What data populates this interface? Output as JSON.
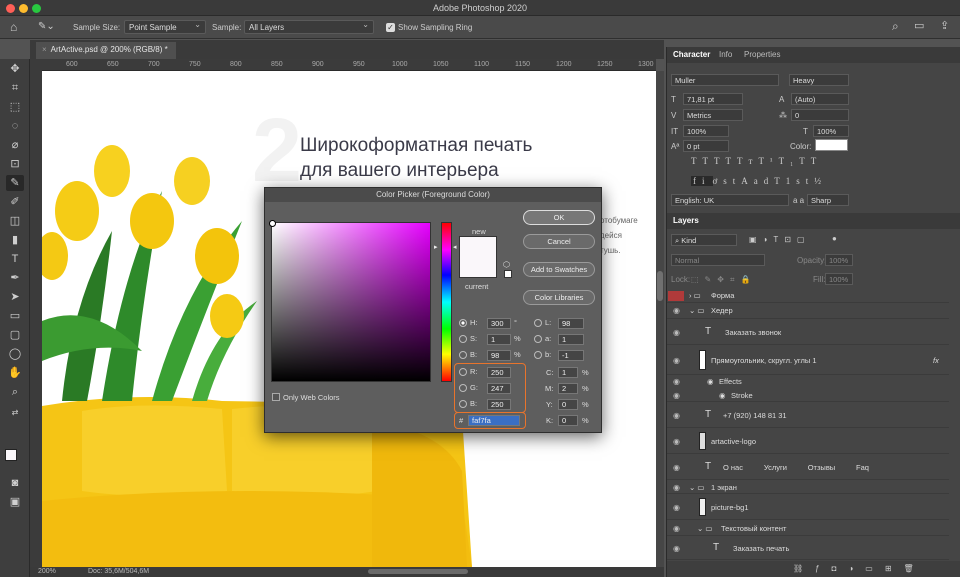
{
  "app": {
    "title": "Adobe Photoshop 2020"
  },
  "options_bar": {
    "sample_size_label": "Sample Size:",
    "sample_size_value": "Point Sample",
    "sample_label": "Sample:",
    "sample_value": "All Layers",
    "sampling_ring_label": "Show Sampling Ring"
  },
  "document": {
    "tab_label": "ArtActive.psd @ 200% (RGB/8) *",
    "zoom": "200%",
    "doc_info": "Doc: 35,6M/504,6M"
  },
  "ruler": {
    "ticks": [
      "600",
      "650",
      "700",
      "750",
      "800",
      "850",
      "900",
      "950",
      "1000",
      "1050",
      "1100",
      "1150",
      "1200",
      "1250",
      "1300"
    ]
  },
  "canvas": {
    "heading_line1": "Широкоформатная печать",
    "heading_line2": "для вашего интерьера",
    "side_text": [
      "отобумаге",
      "дейся",
      "тушь."
    ]
  },
  "character_panel": {
    "tabs": [
      "Character",
      "Info",
      "Properties"
    ],
    "font_family": "Muller",
    "font_style": "Heavy",
    "font_size": "71,81 pt",
    "leading": "(Auto)",
    "kerning": "Metrics",
    "tracking": "0",
    "vertical_scale": "100%",
    "horizontal_scale": "100%",
    "baseline_shift": "0 pt",
    "color_label": "Color:",
    "language": "English: UK",
    "antialias_label": "a a",
    "antialias": "Sharp",
    "type_buttons": [
      "T",
      "T",
      "TT",
      "Tт",
      "T¹",
      "T₁",
      "T",
      "T"
    ],
    "ot_buttons": [
      "fi",
      "ơ",
      "st",
      "A",
      "ad",
      "T",
      "1st",
      "½"
    ]
  },
  "layers_panel": {
    "tab": "Layers",
    "filter": "Kind",
    "blend_mode": "Normal",
    "opacity_label": "Opacity:",
    "opacity": "100%",
    "lock_label": "Lock:",
    "fill_label": "Fill:",
    "fill": "100%",
    "layers": [
      {
        "name": "Форма",
        "type": "group"
      },
      {
        "name": "Хедер",
        "type": "group"
      },
      {
        "name": "Заказать звонок",
        "type": "text"
      },
      {
        "name": "Прямоугольник, скругл. углы 1",
        "type": "shape",
        "fx": "fx"
      },
      {
        "name": "Effects",
        "type": "effect"
      },
      {
        "name": "Stroke",
        "type": "effect"
      },
      {
        "name": "+7 (920) 148 81 31",
        "type": "text"
      },
      {
        "name": "artactive-logo",
        "type": "image"
      },
      {
        "name": "О нас          Услуги          Отзывы          Faq",
        "type": "text"
      },
      {
        "name": "1 экран",
        "type": "group"
      },
      {
        "name": "picture-bg1",
        "type": "image"
      },
      {
        "name": "Текстовый контент",
        "type": "group"
      },
      {
        "name": "Заказать печать",
        "type": "text"
      }
    ]
  },
  "color_picker": {
    "title": "Color Picker (Foreground Color)",
    "new_label": "new",
    "current_label": "current",
    "ok": "OK",
    "cancel": "Cancel",
    "add_swatches": "Add to Swatches",
    "color_libraries": "Color Libraries",
    "only_web": "Only Web Colors",
    "H": "300",
    "H_unit": "°",
    "S": "1",
    "S_unit": "%",
    "B": "98",
    "B_unit": "%",
    "R": "250",
    "G": "247",
    "Bv": "250",
    "L": "98",
    "a": "1",
    "b": "-1",
    "C": "1",
    "M": "2",
    "Y": "0",
    "K": "0",
    "pct": "%",
    "hex": "faf7fa",
    "hash": "#",
    "new_color": "#faf7fa"
  }
}
